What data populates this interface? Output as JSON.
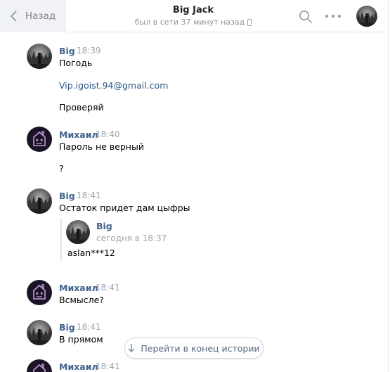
{
  "header": {
    "back_label": "Назад",
    "title": "Big Jack",
    "status": "был в сети 37 минут назад"
  },
  "icons": {
    "back": "chevron-left-icon",
    "search": "search-icon",
    "more": "more-icon",
    "mobile": "phone-icon",
    "jump": "arrow-down-icon"
  },
  "colors": {
    "name": "#42648b",
    "link": "#2a5885",
    "time": "#a0a4a8",
    "header_back_bg": "#f0f2f5",
    "mikhail_avatar_bg": "#1b1426",
    "mikhail_avatar_fg": "#c19ad8"
  },
  "messages": {
    "g1": {
      "name": "Big",
      "time": "18:39",
      "lines": [
        "Погодь",
        "Vip.igoist.94@gmail.com",
        "Проверяй"
      ]
    },
    "g2": {
      "name": "Михаил",
      "time": "18:40",
      "lines": [
        "Пароль не верный",
        "?"
      ]
    },
    "g3": {
      "name": "Big",
      "time": "18:41",
      "lines": [
        "Остаток придет дам цыфры"
      ],
      "forward": {
        "name": "Big",
        "date": "сегодня в 18:37",
        "text": "aslan***12"
      }
    },
    "g4": {
      "name": "Михаил",
      "time": "18:41",
      "lines": [
        "Всмысле?"
      ]
    },
    "g5": {
      "name": "Big",
      "time": "18:41",
      "lines": [
        "В прямом"
      ]
    },
    "g6": {
      "name": "Михаил",
      "time": "18:41"
    }
  },
  "jump_button": "Перейти в конец истории"
}
